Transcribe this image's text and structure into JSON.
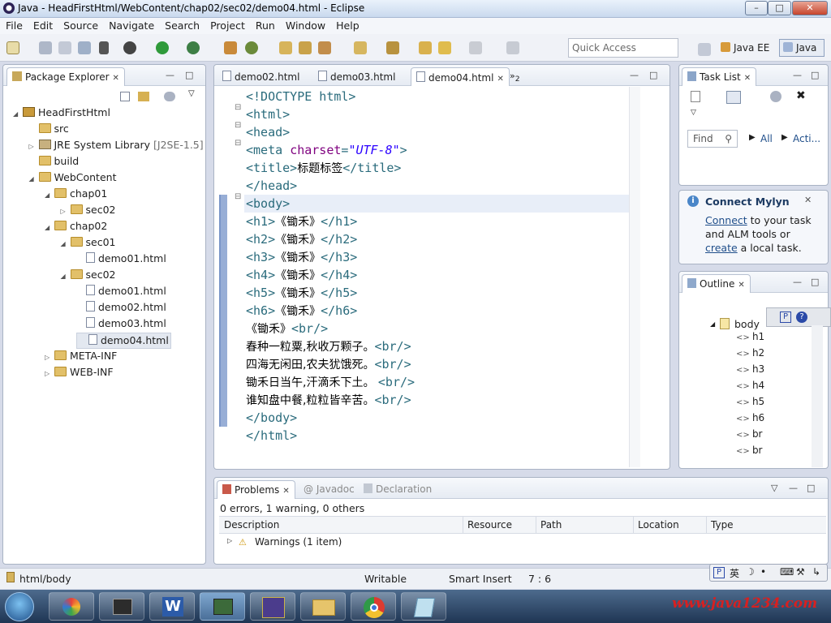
{
  "window": {
    "title": "Java - HeadFirstHtml/WebContent/chap02/sec02/demo04.html - Eclipse"
  },
  "menu": [
    "File",
    "Edit",
    "Source",
    "Navigate",
    "Search",
    "Project",
    "Run",
    "Window",
    "Help"
  ],
  "toolbar": {
    "quick_access_placeholder": "Quick Access",
    "perspective_javaee": "Java EE",
    "perspective_java": "Java"
  },
  "package_explorer": {
    "tab_label": "Package Explorer",
    "tree": [
      {
        "label": "HeadFirstHtml",
        "indent": 0,
        "icon": "project-icon",
        "expanded": true
      },
      {
        "label": "src",
        "indent": 1,
        "icon": "source-folder-icon"
      },
      {
        "label": "JRE System Library",
        "suffix": "[J2SE-1.5]",
        "indent": 1,
        "icon": "library-icon",
        "collapsed": true
      },
      {
        "label": "build",
        "indent": 1,
        "icon": "folder-icon"
      },
      {
        "label": "WebContent",
        "indent": 1,
        "icon": "folder-icon",
        "expanded": true
      },
      {
        "label": "chap01",
        "indent": 2,
        "icon": "folder-icon",
        "expanded": true
      },
      {
        "label": "sec02",
        "indent": 3,
        "icon": "folder-icon",
        "collapsed": true
      },
      {
        "label": "chap02",
        "indent": 2,
        "icon": "folder-icon",
        "expanded": true
      },
      {
        "label": "sec01",
        "indent": 3,
        "icon": "folder-icon",
        "expanded": true
      },
      {
        "label": "demo01.html",
        "indent": 4,
        "icon": "html-file-icon"
      },
      {
        "label": "sec02",
        "indent": 3,
        "icon": "folder-icon",
        "expanded": true
      },
      {
        "label": "demo01.html",
        "indent": 4,
        "icon": "html-file-icon"
      },
      {
        "label": "demo02.html",
        "indent": 4,
        "icon": "html-file-icon"
      },
      {
        "label": "demo03.html",
        "indent": 4,
        "icon": "html-file-icon"
      },
      {
        "label": "demo04.html",
        "indent": 4,
        "icon": "html-file-icon",
        "selected": true
      },
      {
        "label": "META-INF",
        "indent": 2,
        "icon": "folder-icon",
        "collapsed": true
      },
      {
        "label": "WEB-INF",
        "indent": 2,
        "icon": "folder-icon",
        "collapsed": true
      }
    ]
  },
  "editor": {
    "tabs": [
      {
        "label": "demo02.html"
      },
      {
        "label": "demo03.html"
      },
      {
        "label": "demo04.html",
        "active": true
      }
    ],
    "overflow_label": "2",
    "lines": [
      [
        [
          "t",
          "<!DOCTYPE html>"
        ]
      ],
      [
        [
          "t",
          "<html>"
        ]
      ],
      [
        [
          "t",
          "<head>"
        ]
      ],
      [
        [
          "t",
          "<meta "
        ],
        [
          "a",
          "charset"
        ],
        [
          "t",
          "="
        ],
        [
          "s",
          "\"UTF-8\""
        ],
        [
          "t",
          ">"
        ]
      ],
      [
        [
          "t",
          "<title>"
        ],
        [
          "x",
          "标题标签"
        ],
        [
          "t",
          "</title>"
        ]
      ],
      [
        [
          "t",
          "</head>"
        ]
      ],
      [
        [
          "t",
          "<body>"
        ]
      ],
      [
        [
          "t",
          "<h1>"
        ],
        [
          "x",
          "《锄禾》"
        ],
        [
          "t",
          "</h1>"
        ]
      ],
      [
        [
          "t",
          "<h2>"
        ],
        [
          "x",
          "《锄禾》"
        ],
        [
          "t",
          "</h2>"
        ]
      ],
      [
        [
          "t",
          "<h3>"
        ],
        [
          "x",
          "《锄禾》"
        ],
        [
          "t",
          "</h3>"
        ]
      ],
      [
        [
          "t",
          "<h4>"
        ],
        [
          "x",
          "《锄禾》"
        ],
        [
          "t",
          "</h4>"
        ]
      ],
      [
        [
          "t",
          "<h5>"
        ],
        [
          "x",
          "《锄禾》"
        ],
        [
          "t",
          "</h5>"
        ]
      ],
      [
        [
          "t",
          "<h6>"
        ],
        [
          "x",
          "《锄禾》"
        ],
        [
          "t",
          "</h6>"
        ]
      ],
      [
        [
          "x",
          "《锄禾》"
        ],
        [
          "t",
          "<br/>"
        ]
      ],
      [
        [
          "x",
          "春种一粒粟,秋收万颗子。"
        ],
        [
          "t",
          "<br/>"
        ]
      ],
      [
        [
          "x",
          "四海无闲田,农夫犹饿死。"
        ],
        [
          "t",
          "<br/>"
        ]
      ],
      [
        [
          "x",
          "锄禾日当午,汗滴禾下土。 "
        ],
        [
          "t",
          "<br/>"
        ]
      ],
      [
        [
          "x",
          "谁知盘中餐,粒粒皆辛苦。"
        ],
        [
          "t",
          "<br/>"
        ]
      ],
      [
        [
          "t",
          "</body>"
        ]
      ],
      [
        [
          "t",
          "</html>"
        ]
      ]
    ]
  },
  "task_list": {
    "tab_label": "Task List",
    "find_placeholder": "Find",
    "all_label": "All",
    "activate_label": "Acti..."
  },
  "mylyn": {
    "title": "Connect Mylyn",
    "connect_link": "Connect",
    "text1": " to your task",
    "text2": "and ALM tools or",
    "create_link": "create",
    "text3": " a local task."
  },
  "outline": {
    "tab_label": "Outline",
    "root": "body",
    "children": [
      "h1",
      "h2",
      "h3",
      "h4",
      "h5",
      "h6",
      "br",
      "br"
    ]
  },
  "problems": {
    "tabs": [
      "Problems",
      "Javadoc",
      "Declaration"
    ],
    "summary": "0 errors, 1 warning, 0 others",
    "columns": [
      "Description",
      "Resource",
      "Path",
      "Location",
      "Type"
    ],
    "rows": [
      {
        "label": "Warnings (1 item)"
      }
    ]
  },
  "status": {
    "path": "html/body",
    "mode": "Writable",
    "insert": "Smart Insert",
    "position": "7 : 6"
  },
  "ime": {
    "lang": "英"
  },
  "watermark": "www.java1234.com"
}
